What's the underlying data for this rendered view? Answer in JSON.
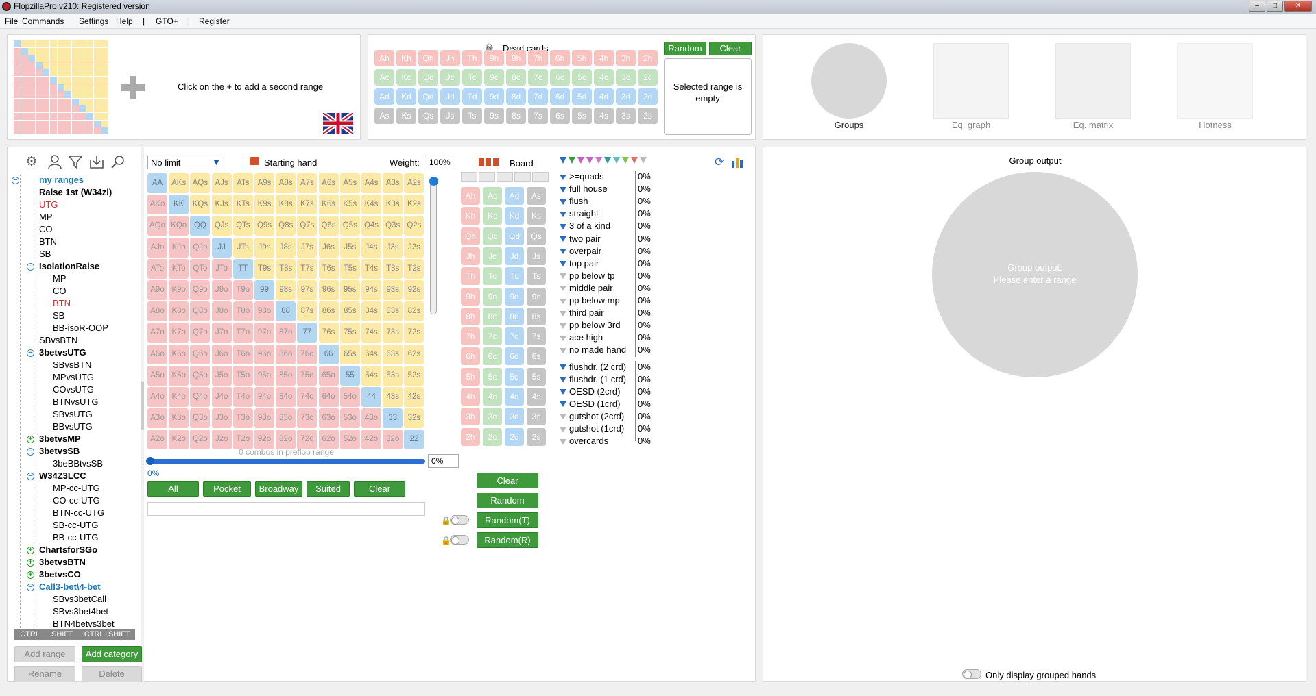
{
  "window": {
    "title": "FlopzillaPro v210: Registered version"
  },
  "menu": [
    "File",
    "Commands",
    "Settings",
    "Help",
    "|",
    "GTO+",
    "|",
    "Register"
  ],
  "top_range": {
    "add_hint": "Click on the + to add a second range"
  },
  "dead_cards": {
    "title": "Dead cards",
    "random_label": "Random",
    "clear_label": "Clear",
    "selected_text": "Selected range is empty",
    "rows": [
      [
        "Ah",
        "Kh",
        "Qh",
        "Jh",
        "Th",
        "9h",
        "8h",
        "7h",
        "6h",
        "5h",
        "4h",
        "3h",
        "2h"
      ],
      [
        "Ac",
        "Kc",
        "Qc",
        "Jc",
        "Tc",
        "9c",
        "8c",
        "7c",
        "6c",
        "5c",
        "4c",
        "3c",
        "2c"
      ],
      [
        "Ad",
        "Kd",
        "Qd",
        "Jd",
        "Td",
        "9d",
        "8d",
        "7d",
        "6d",
        "5d",
        "4d",
        "3d",
        "2d"
      ],
      [
        "As",
        "Ks",
        "Qs",
        "Js",
        "Ts",
        "9s",
        "8s",
        "7s",
        "6s",
        "5s",
        "4s",
        "3s",
        "2s"
      ]
    ]
  },
  "views": {
    "tabs": [
      "Groups",
      "Eq. graph",
      "Eq. matrix",
      "Hotness"
    ],
    "active": "Groups"
  },
  "sidebar": {
    "tree": [
      {
        "t": "my ranges",
        "lvl": 0,
        "c": "cat",
        "ic": "minus"
      },
      {
        "t": "Raise 1st (W34zl)",
        "lvl": 1,
        "c": "bold"
      },
      {
        "t": "UTG",
        "lvl": 1,
        "c": "red"
      },
      {
        "t": "MP",
        "lvl": 1,
        "c": ""
      },
      {
        "t": "CO",
        "lvl": 1,
        "c": ""
      },
      {
        "t": "BTN",
        "lvl": 1,
        "c": ""
      },
      {
        "t": "SB",
        "lvl": 1,
        "c": ""
      },
      {
        "t": "IsolationRaise",
        "lvl": 1,
        "c": "bold",
        "ic": "minus"
      },
      {
        "t": "MP",
        "lvl": 2,
        "c": ""
      },
      {
        "t": "CO",
        "lvl": 2,
        "c": ""
      },
      {
        "t": "BTN",
        "lvl": 2,
        "c": "red"
      },
      {
        "t": "SB",
        "lvl": 2,
        "c": ""
      },
      {
        "t": "BB-isoR-OOP",
        "lvl": 2,
        "c": ""
      },
      {
        "t": "SBvsBTN",
        "lvl": 1,
        "c": ""
      },
      {
        "t": "3betvsUTG",
        "lvl": 1,
        "c": "bold",
        "ic": "minus"
      },
      {
        "t": "SBvsBTN",
        "lvl": 2,
        "c": ""
      },
      {
        "t": "MPvsUTG",
        "lvl": 2,
        "c": ""
      },
      {
        "t": "COvsUTG",
        "lvl": 2,
        "c": ""
      },
      {
        "t": "BTNvsUTG",
        "lvl": 2,
        "c": ""
      },
      {
        "t": "SBvsUTG",
        "lvl": 2,
        "c": ""
      },
      {
        "t": "BBvsUTG",
        "lvl": 2,
        "c": ""
      },
      {
        "t": "3betvsMP",
        "lvl": 1,
        "c": "bold",
        "ic": "plus"
      },
      {
        "t": "3betvsSB",
        "lvl": 1,
        "c": "bold",
        "ic": "minus"
      },
      {
        "t": "3beBBtvsSB",
        "lvl": 2,
        "c": ""
      },
      {
        "t": "W34Z3LCC",
        "lvl": 1,
        "c": "bold",
        "ic": "minus"
      },
      {
        "t": "MP-cc-UTG",
        "lvl": 2,
        "c": ""
      },
      {
        "t": "CO-cc-UTG",
        "lvl": 2,
        "c": ""
      },
      {
        "t": "BTN-cc-UTG",
        "lvl": 2,
        "c": ""
      },
      {
        "t": "SB-cc-UTG",
        "lvl": 2,
        "c": ""
      },
      {
        "t": "BB-cc-UTG",
        "lvl": 2,
        "c": ""
      },
      {
        "t": "ChartsforSGo",
        "lvl": 1,
        "c": "bold",
        "ic": "plus"
      },
      {
        "t": "3betvsBTN",
        "lvl": 1,
        "c": "bold",
        "ic": "plus"
      },
      {
        "t": "3betvsCO",
        "lvl": 1,
        "c": "bold",
        "ic": "plus"
      },
      {
        "t": "Call3-bet\\4-bet",
        "lvl": 1,
        "c": "cat",
        "ic": "minus"
      },
      {
        "t": "SBvs3betCall",
        "lvl": 2,
        "c": ""
      },
      {
        "t": "SBvs3bet4bet",
        "lvl": 2,
        "c": ""
      },
      {
        "t": "BTN4betvs3bet",
        "lvl": 2,
        "c": ""
      }
    ],
    "mods": [
      "CTRL",
      "SHIFT",
      "CTRL+SHIFT"
    ],
    "add_range": "Add range",
    "add_category": "Add category",
    "rename": "Rename",
    "delete": "Delete"
  },
  "matrix": {
    "limit": "No limit",
    "starting_hand": "Starting hand",
    "weight_label": "Weight:",
    "weight_value": "100%",
    "combos_text": "0 combos in preflop range",
    "slider_value": "0%",
    "slider_pct": "0%",
    "buttons": [
      "All",
      "Pocket",
      "Broadway",
      "Suited",
      "Clear"
    ],
    "ranks": [
      "A",
      "K",
      "Q",
      "J",
      "T",
      "9",
      "8",
      "7",
      "6",
      "5",
      "4",
      "3",
      "2"
    ]
  },
  "board": {
    "title": "Board",
    "clear": "Clear",
    "random": "Random",
    "random_t": "Random(T)",
    "random_r": "Random(R)",
    "ranks": [
      "A",
      "K",
      "Q",
      "J",
      "T",
      "9",
      "8",
      "7",
      "6",
      "5",
      "4",
      "3",
      "2"
    ],
    "suits": [
      "h",
      "c",
      "d",
      "s"
    ]
  },
  "filters": {
    "made": [
      {
        "t": ">=quads",
        "v": "0%",
        "a": true
      },
      {
        "t": "full house",
        "v": "0%",
        "a": true
      },
      {
        "t": "flush",
        "v": "0%",
        "a": true
      },
      {
        "t": "straight",
        "v": "0%",
        "a": true
      },
      {
        "t": "3 of a kind",
        "v": "0%",
        "a": true
      },
      {
        "t": "two pair",
        "v": "0%",
        "a": true
      },
      {
        "t": "overpair",
        "v": "0%",
        "a": true
      },
      {
        "t": "top pair",
        "v": "0%",
        "a": true
      },
      {
        "t": "pp below tp",
        "v": "0%",
        "a": false
      },
      {
        "t": "middle pair",
        "v": "0%",
        "a": false
      },
      {
        "t": "pp below mp",
        "v": "0%",
        "a": false
      },
      {
        "t": "third pair",
        "v": "0%",
        "a": false
      },
      {
        "t": "pp below 3rd",
        "v": "0%",
        "a": false
      },
      {
        "t": "ace high",
        "v": "0%",
        "a": false
      },
      {
        "t": "no made hand",
        "v": "0%",
        "a": false
      }
    ],
    "draws": [
      {
        "t": "flushdr. (2 crd)",
        "v": "0%",
        "a": true
      },
      {
        "t": "flushdr. (1 crd)",
        "v": "0%",
        "a": true
      },
      {
        "t": "OESD (2crd)",
        "v": "0%",
        "a": true
      },
      {
        "t": "OESD (1crd)",
        "v": "0%",
        "a": true
      },
      {
        "t": "gutshot (2crd)",
        "v": "0%",
        "a": false
      },
      {
        "t": "gutshot (1crd)",
        "v": "0%",
        "a": false
      },
      {
        "t": "overcards",
        "v": "0%",
        "a": false
      }
    ]
  },
  "output": {
    "title": "Group output",
    "placeholder_l1": "Group output:",
    "placeholder_l2": "Please enter a range",
    "only_grouped": "Only display grouped hands"
  },
  "colors": {
    "green": "#3f9a3c",
    "pair": "#b4d7f1",
    "suited": "#fce9a6",
    "offsuit": "#f6c4c4"
  }
}
